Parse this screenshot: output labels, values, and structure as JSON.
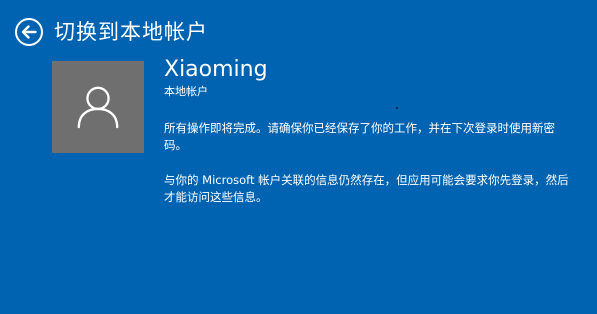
{
  "colors": {
    "background": "#0063b1",
    "avatar_tile": "#6f6f6f",
    "text": "#ffffff"
  },
  "header": {
    "back_icon": "back-arrow-circle-icon",
    "title": "切换到本地帐户"
  },
  "account": {
    "avatar_icon": "user-silhouette-icon",
    "username": "Xiaoming",
    "type_label": "本地帐户"
  },
  "messages": {
    "paragraph1": "所有操作即将完成。请确保你已经保存了你的工作，并在下次登录时使用新密码。",
    "paragraph2": "与你的 Microsoft 帐户关联的信息仍然存在，但应用可能会要求你先登录，然后才能访问这些信息。"
  }
}
